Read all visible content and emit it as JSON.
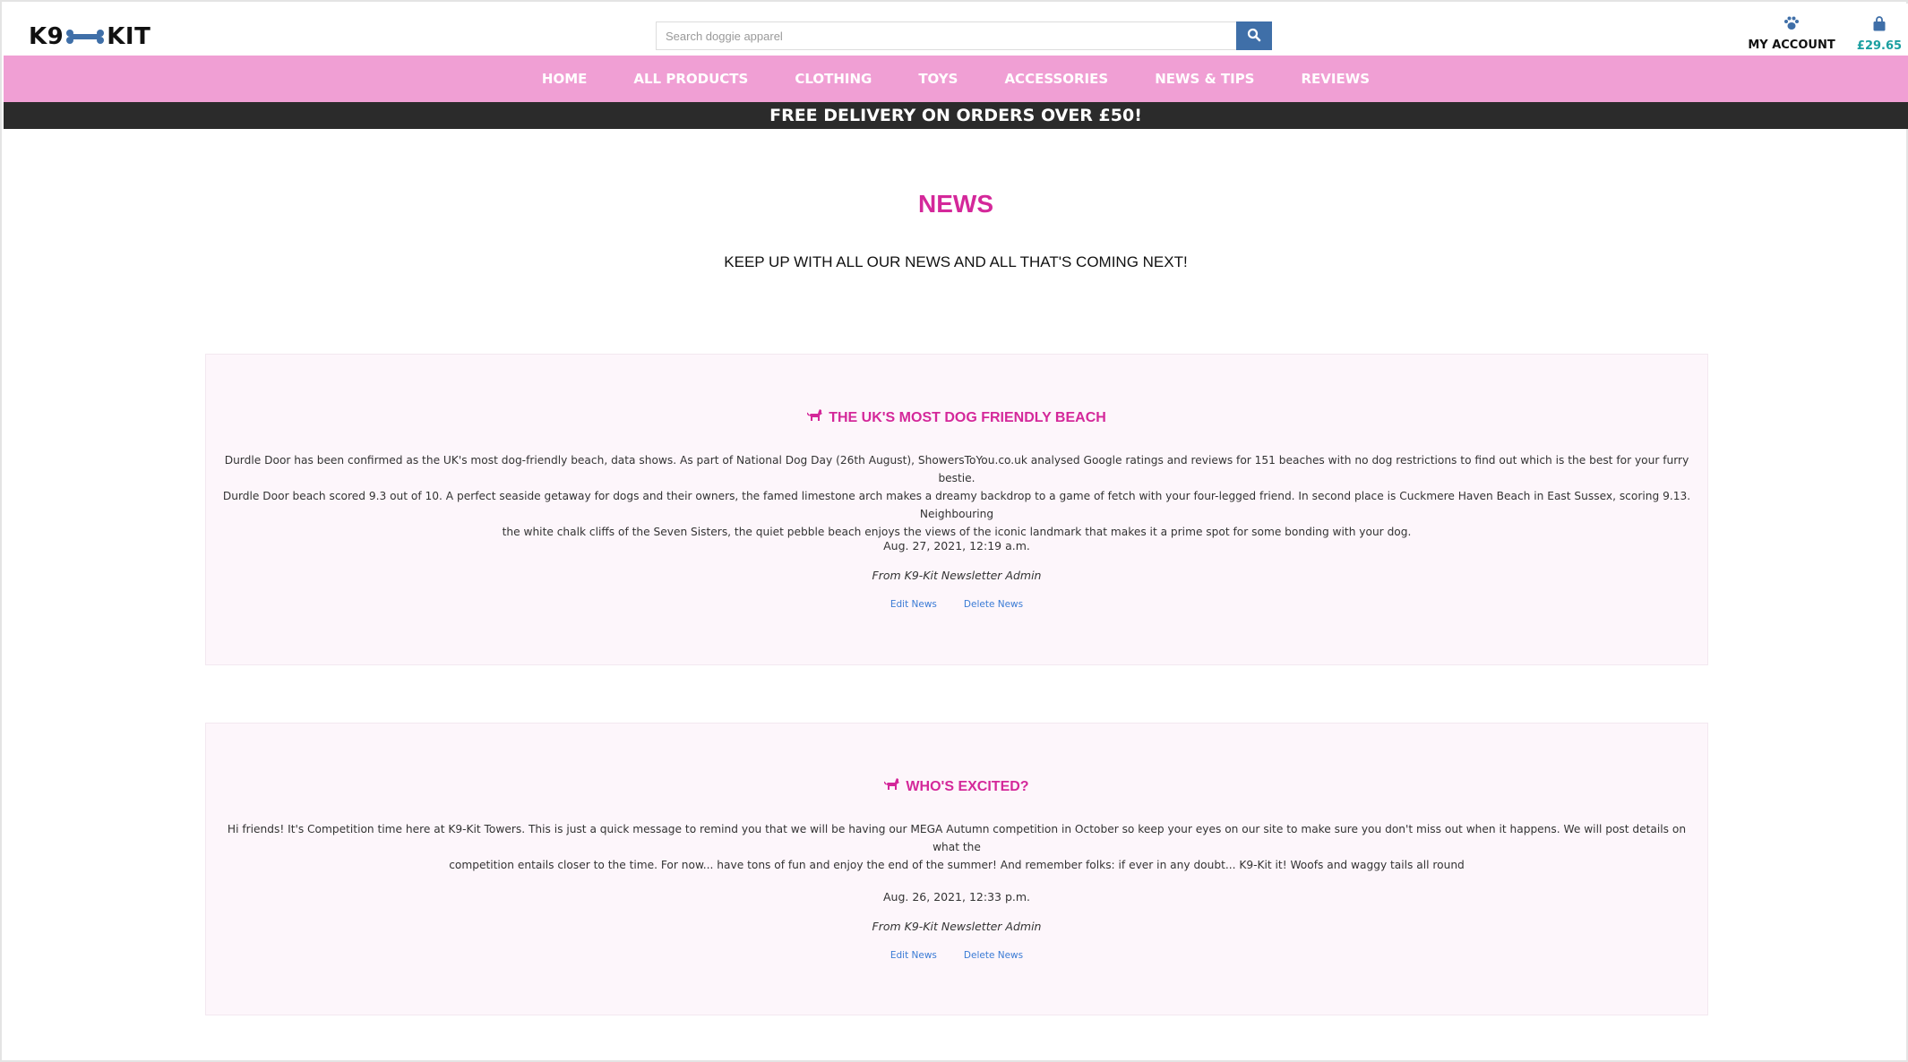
{
  "brand": {
    "logo_left": "K9",
    "logo_right": "KIT"
  },
  "search": {
    "placeholder": "Search doggie apparel"
  },
  "account": {
    "label": "MY ACCOUNT",
    "icon": "paw-icon"
  },
  "cart": {
    "total": "£29.65",
    "icon": "shopping-bag-icon"
  },
  "nav": {
    "items": [
      "HOME",
      "ALL PRODUCTS",
      "CLOTHING",
      "TOYS",
      "ACCESSORIES",
      "NEWS & TIPS",
      "REVIEWS"
    ]
  },
  "banner": {
    "text": "FREE DELIVERY ON ORDERS OVER £50!"
  },
  "page": {
    "title": "NEWS",
    "subtitle": "KEEP UP WITH ALL OUR NEWS AND ALL THAT'S COMING NEXT!"
  },
  "news": [
    {
      "title": "THE UK'S MOST DOG FRIENDLY BEACH",
      "body_lines": [
        "Durdle Door has been confirmed as the UK's most dog-friendly beach, data shows. As part of National Dog Day (26th August), ShowersToYou.co.uk analysed Google ratings and reviews for 151 beaches with no dog restrictions to find out which is the best for your furry bestie.",
        "Durdle Door beach scored 9.3 out of 10. A perfect seaside getaway for dogs and their owners, the famed limestone arch makes a dreamy backdrop to a game of fetch with your four-legged friend. In second place is Cuckmere Haven Beach in East Sussex, scoring 9.13. Neighbouring",
        "the white chalk cliffs of the Seven Sisters, the quiet pebble beach enjoys the views of the iconic landmark that makes it a prime spot for some bonding with your dog."
      ],
      "date": "Aug. 27, 2021, 12:19 a.m.",
      "author": "From K9-Kit Newsletter Admin",
      "edit_label": "Edit News",
      "delete_label": "Delete News"
    },
    {
      "title": "WHO'S EXCITED?",
      "body_lines": [
        "Hi friends! It's Competition time here at K9-Kit Towers. This is just a quick message to remind you that we will be having our MEGA Autumn competition in October so keep your eyes on our site to make sure you don't miss out when it happens. We will post details on what the",
        "competition entails closer to the time. For now... have tons of fun and enjoy the end of the summer! And remember folks: if ever in any doubt... K9-Kit it! Woofs and waggy tails all round"
      ],
      "date": "Aug. 26, 2021, 12:33 p.m.",
      "author": "From K9-Kit Newsletter Admin",
      "edit_label": "Edit News",
      "delete_label": "Delete News"
    }
  ],
  "colors": {
    "accent_pink": "#d4289a",
    "nav_pink": "#f09fd4",
    "banner_dark": "#2b2b2b",
    "search_button": "#3f6fa8",
    "cart_total": "#1a9fa0",
    "link_blue": "#3a7bd5",
    "card_bg": "#fdf6fb"
  }
}
